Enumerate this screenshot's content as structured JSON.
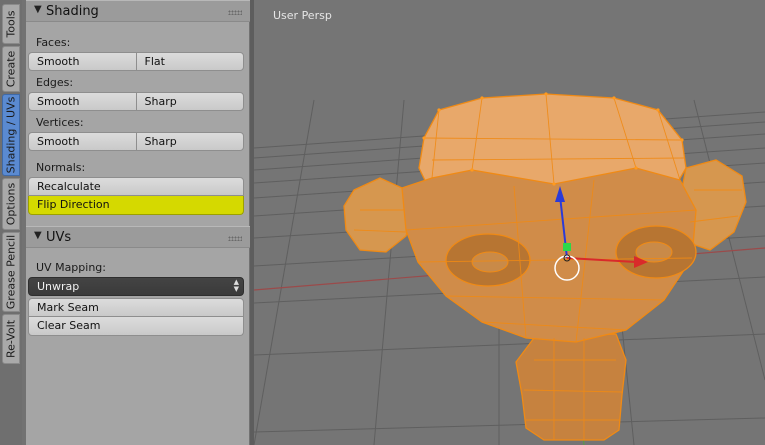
{
  "tabs": [
    "Tools",
    "Create",
    "Shading / UVs",
    "Options",
    "Grease Pencil",
    "Re-Volt"
  ],
  "active_tab": "Shading / UVs",
  "shading_panel": {
    "title": "Shading",
    "faces_label": "Faces:",
    "faces_smooth": "Smooth",
    "faces_flat": "Flat",
    "edges_label": "Edges:",
    "edges_smooth": "Smooth",
    "edges_sharp": "Sharp",
    "vertices_label": "Vertices:",
    "vertices_smooth": "Smooth",
    "vertices_sharp": "Sharp",
    "normals_label": "Normals:",
    "recalculate": "Recalculate",
    "flip_direction": "Flip Direction"
  },
  "uvs_panel": {
    "title": "UVs",
    "uv_mapping_label": "UV Mapping:",
    "uv_mapping_value": "Unwrap",
    "mark_seam": "Mark Seam",
    "clear_seam": "Clear Seam"
  },
  "viewport": {
    "title": "User Persp",
    "object": "monkey-mesh",
    "selection_color": "#f08a14",
    "mesh_color": "#e8a86a"
  },
  "colors": {
    "panel_bg": "#a5a5a5",
    "active_tab": "#5a8ad1",
    "highlight_button": "#d5d900",
    "viewport_bg": "#757575"
  }
}
